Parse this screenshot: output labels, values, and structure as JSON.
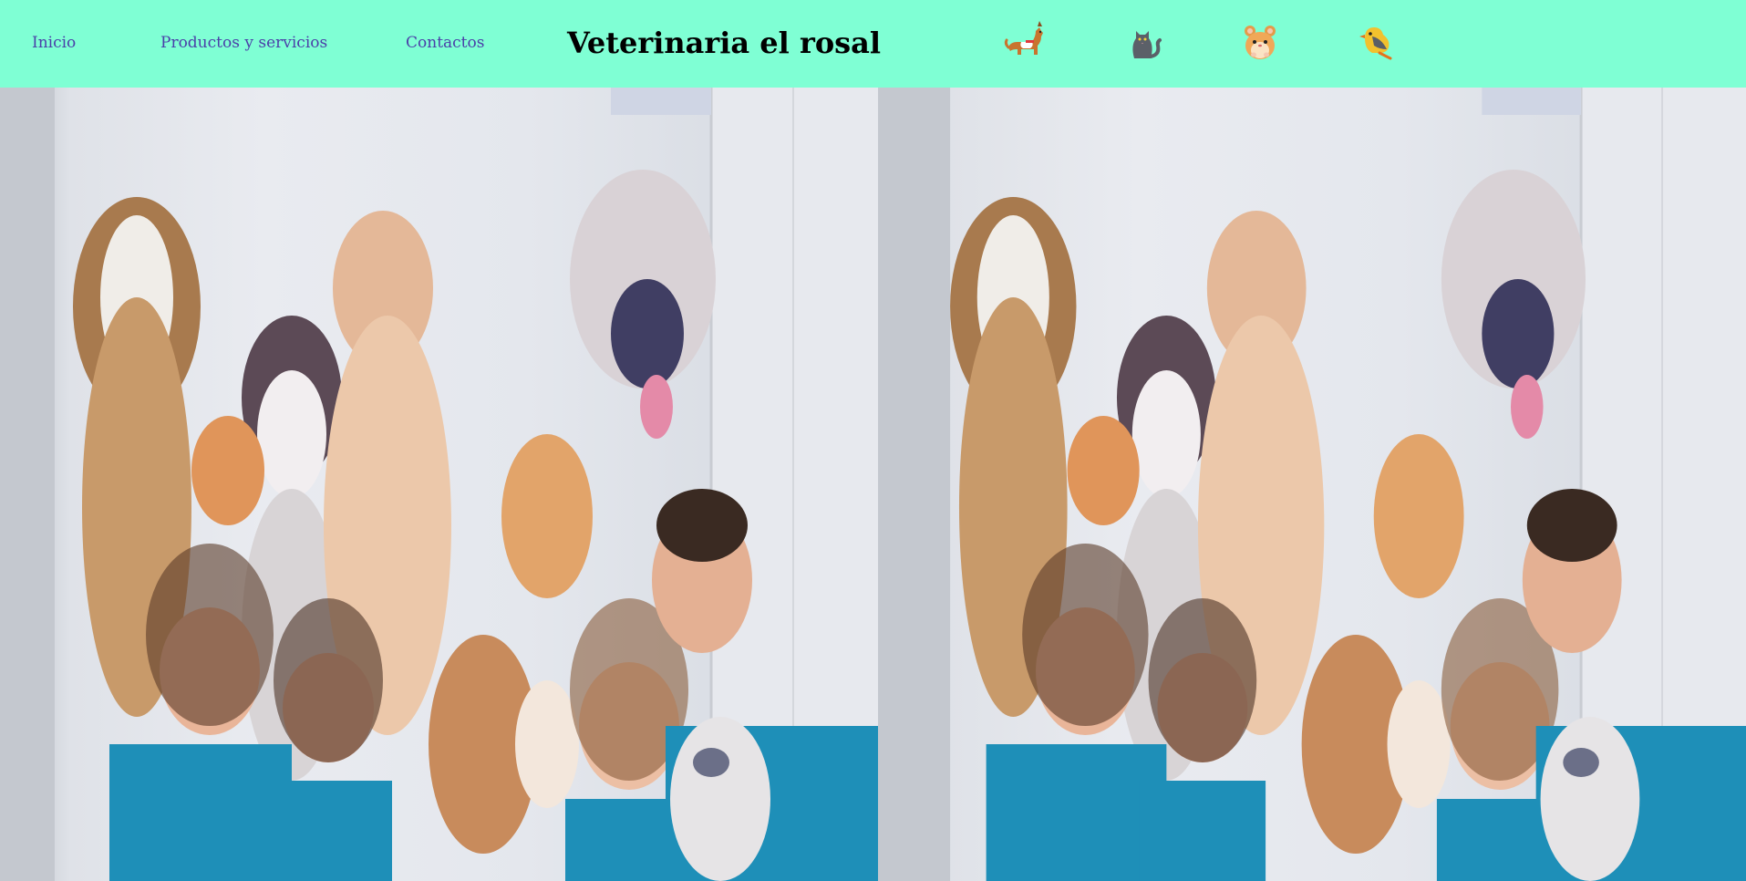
{
  "nav": {
    "links": [
      {
        "label": "Inicio"
      },
      {
        "label": "Productos y servicios"
      },
      {
        "label": "Contactos"
      }
    ],
    "title": "Veterinaria el rosal",
    "icons": [
      {
        "name": "dog-icon"
      },
      {
        "name": "cat-icon"
      },
      {
        "name": "hamster-icon"
      },
      {
        "name": "bird-icon"
      }
    ],
    "background_color": "#7fffd4",
    "link_color": "#4b3fa8"
  },
  "hero": {
    "images": [
      {
        "name": "veterinary-team-photo"
      },
      {
        "name": "veterinary-team-photo"
      }
    ]
  }
}
